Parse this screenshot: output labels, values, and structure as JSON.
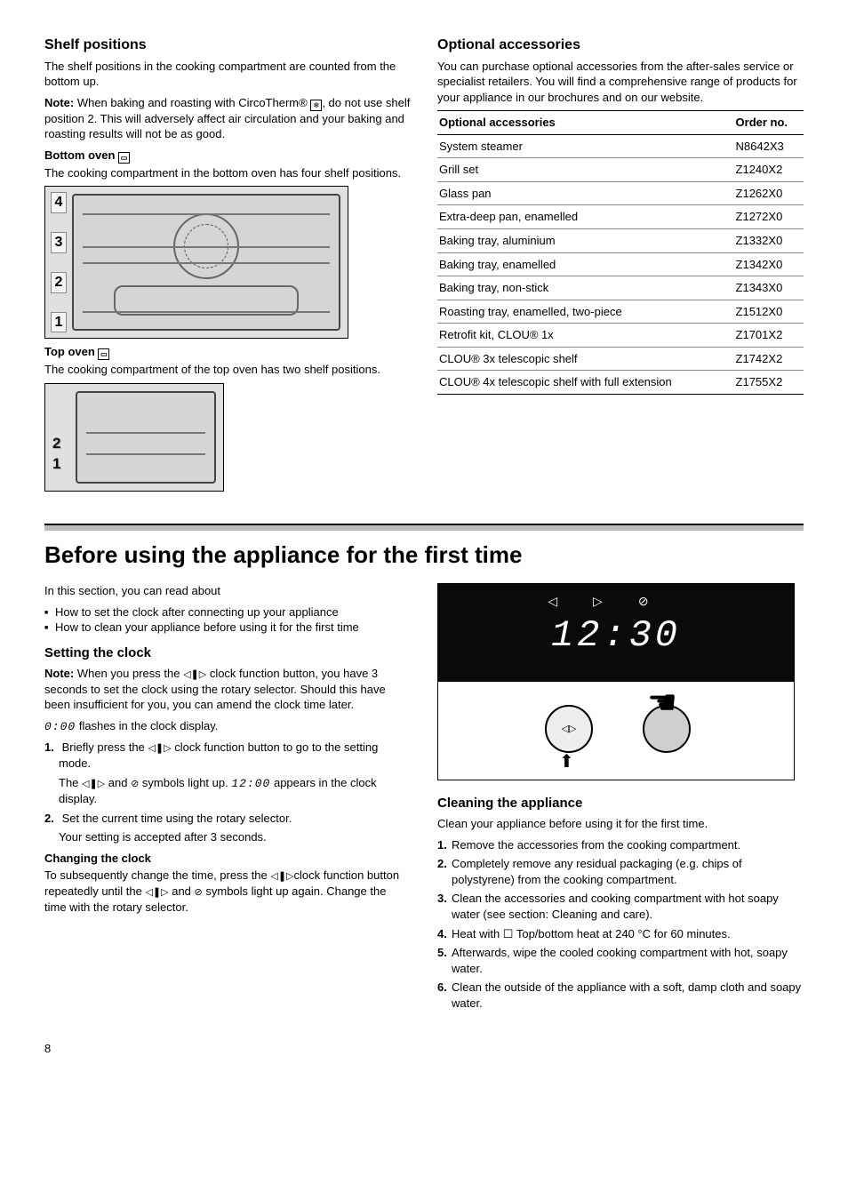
{
  "left": {
    "shelf_title": "Shelf positions",
    "shelf_intro": "The shelf positions in the cooking compartment are counted from the bottom up.",
    "note_label": "Note:",
    "shelf_note": " When baking and roasting with CircoTherm® ",
    "shelf_note_after": ", do not use shelf position 2. This will adversely affect air circulation and your baking and roasting results will not be as good.",
    "bottom_oven_label": "Bottom oven ",
    "bottom_oven_text": "The cooking compartment in the bottom oven has four shelf positions.",
    "fig1_levels": [
      "4",
      "3",
      "2",
      "1"
    ],
    "top_oven_label": "Top oven ",
    "top_oven_text": "The cooking compartment of the top oven has two shelf positions.",
    "fig2_levels": [
      "2",
      "1"
    ]
  },
  "right": {
    "opt_title": "Optional accessories",
    "opt_intro": "You can purchase optional accessories from the after-sales service or specialist retailers. You will find a comprehensive range of products for your appliance in our brochures and on our website.",
    "th1": "Optional accessories",
    "th2": "Order no.",
    "rows": [
      {
        "a": "System steamer",
        "b": "N8642X3"
      },
      {
        "a": "Grill set",
        "b": "Z1240X2"
      },
      {
        "a": "Glass pan",
        "b": "Z1262X0"
      },
      {
        "a": "Extra-deep pan, enamelled",
        "b": "Z1272X0"
      },
      {
        "a": "Baking tray, aluminium",
        "b": "Z1332X0"
      },
      {
        "a": "Baking tray, enamelled",
        "b": "Z1342X0"
      },
      {
        "a": "Baking tray, non-stick",
        "b": "Z1343X0"
      },
      {
        "a": "Roasting tray, enamelled, two-piece",
        "b": "Z1512X0"
      },
      {
        "a": "Retrofit kit, CLOU® 1x",
        "b": "Z1701X2"
      },
      {
        "a": "CLOU® 3x telescopic shelf",
        "b": "Z1742X2"
      },
      {
        "a": "CLOU® 4x telescopic shelf with full extension",
        "b": "Z1755X2"
      }
    ]
  },
  "section2": {
    "heading": "Before using the appliance for the first time",
    "intro": "In this section, you can read about",
    "bullets": [
      "How to set the clock after connecting up your appliance",
      "How to clean your appliance before using it for the first time"
    ],
    "clock_title": "Setting the clock",
    "clock_note": " When you press the ",
    "clock_note2": " clock function button, you have 3 seconds to set the clock using the rotary selector. Should this have been insufficient for you, you can amend the clock time later.",
    "flash_val": "0:00",
    "flash_text": " flashes in the clock display.",
    "step1a": "Briefly press the ",
    "step1b": " clock function button to go to the setting mode.",
    "step1c_a": "The ",
    "step1c_b": " and ",
    "step1c_c": " symbols light up. ",
    "step1c_val": "12:00",
    "step1c_d": " appears in the clock display.",
    "step2a": "Set the current time using the rotary selector.",
    "step2b": "Your setting is accepted after 3 seconds.",
    "change_head": "Changing the clock",
    "change_a": "To subsequently change the time, press the ",
    "change_b": "clock function button repeatedly until the ",
    "change_c": " and ",
    "change_d": " symbols light up again. Change the time with the rotary selector.",
    "display_time": "12:30",
    "clean_title": "Cleaning the appliance",
    "clean_intro": "Clean your appliance before using it for the first time.",
    "clean_steps": [
      "Remove the accessories from the cooking compartment.",
      "Completely remove any residual packaging (e.g. chips of polystyrene) from the cooking compartment.",
      "Clean the accessories and cooking compartment with hot soapy water (see section: Cleaning and care).",
      "Heat with ☐ Top/bottom heat at 240 °C for 60 minutes.",
      "Afterwards, wipe the cooled cooking compartment with hot, soapy water.",
      "Clean the outside of the appliance with a soft, damp cloth and soapy water."
    ]
  },
  "pagenum": "8",
  "icons": {
    "fan": "✻",
    "oven": "▭",
    "clock_arrows": "◁▷",
    "clock_arrows_filled": "◁❚▷",
    "timer": "⊘",
    "heat": "☐"
  }
}
